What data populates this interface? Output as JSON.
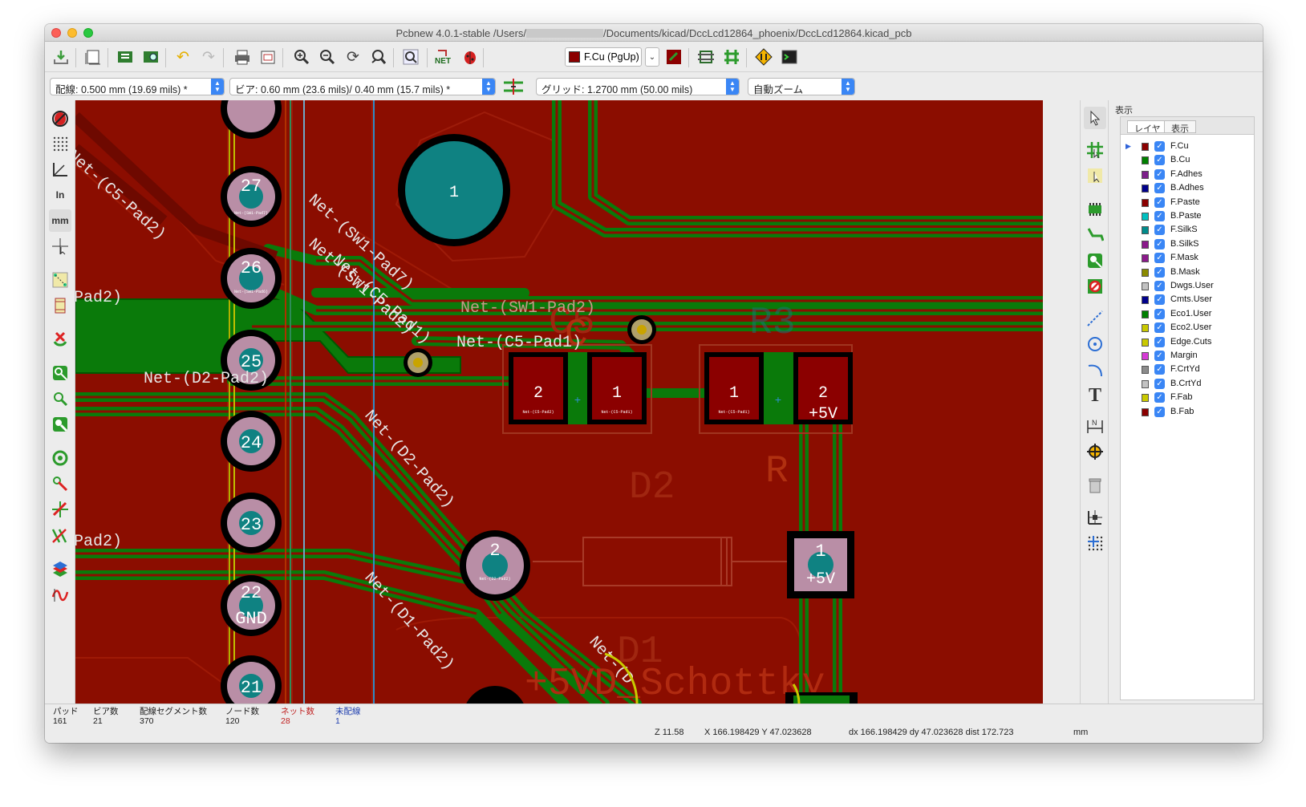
{
  "window": {
    "title_prefix": "Pcbnew 4.0.1-stable /Users/",
    "title_suffix": "/Documents/kicad/DccLcd12864_phoenix/DccLcd12864.kicad_pcb"
  },
  "toolbar": {
    "active_layer": "F.Cu (PgUp)",
    "layer_color": "#8b0000"
  },
  "toolbar2": {
    "track_width": "配線: 0.500 mm (19.69 mils) *",
    "via_size": "ビア: 0.60 mm (23.6 mils)/ 0.40 mm (15.7 mils) *",
    "grid": "グリッド: 1.2700 mm (50.00 mils)",
    "zoom": "自動ズーム"
  },
  "panel": {
    "title": "表示",
    "tabs": [
      "レイヤ",
      "表示"
    ],
    "layers": [
      {
        "name": "F.Cu",
        "color": "#8b0000",
        "checked": true,
        "active": true
      },
      {
        "name": "B.Cu",
        "color": "#008000",
        "checked": true,
        "active": false
      },
      {
        "name": "F.Adhes",
        "color": "#7d1f8a",
        "checked": true,
        "active": false
      },
      {
        "name": "B.Adhes",
        "color": "#00008b",
        "checked": true,
        "active": false
      },
      {
        "name": "F.Paste",
        "color": "#8b0000",
        "checked": true,
        "active": false
      },
      {
        "name": "B.Paste",
        "color": "#00c0c0",
        "checked": true,
        "active": false
      },
      {
        "name": "F.SilkS",
        "color": "#008b8b",
        "checked": true,
        "active": false
      },
      {
        "name": "B.SilkS",
        "color": "#8b1a8b",
        "checked": true,
        "active": false
      },
      {
        "name": "F.Mask",
        "color": "#8b1a8b",
        "checked": true,
        "active": false
      },
      {
        "name": "B.Mask",
        "color": "#8b8b00",
        "checked": true,
        "active": false
      },
      {
        "name": "Dwgs.User",
        "color": "#c2c2c2",
        "checked": true,
        "active": false
      },
      {
        "name": "Cmts.User",
        "color": "#00008b",
        "checked": true,
        "active": false
      },
      {
        "name": "Eco1.User",
        "color": "#008000",
        "checked": true,
        "active": false
      },
      {
        "name": "Eco2.User",
        "color": "#c9c900",
        "checked": true,
        "active": false
      },
      {
        "name": "Edge.Cuts",
        "color": "#c9c900",
        "checked": true,
        "active": false
      },
      {
        "name": "Margin",
        "color": "#d63ad6",
        "checked": true,
        "active": false
      },
      {
        "name": "F.CrtYd",
        "color": "#8b8b8b",
        "checked": true,
        "active": false
      },
      {
        "name": "B.CrtYd",
        "color": "#c2c2c2",
        "checked": true,
        "active": false
      },
      {
        "name": "F.Fab",
        "color": "#c9c900",
        "checked": true,
        "active": false
      },
      {
        "name": "B.Fab",
        "color": "#8b0000",
        "checked": true,
        "active": false
      }
    ]
  },
  "status": {
    "pads_label": "パッド",
    "pads": "161",
    "vias_label": "ビア数",
    "vias": "21",
    "segments_label": "配線セグメント数",
    "segments": "370",
    "nodes_label": "ノード数",
    "nodes": "120",
    "nets_label": "ネット数",
    "nets": "28",
    "unrouted_label": "未配線",
    "unrouted": "1",
    "zoom": "Z 11.58",
    "xy": "X 166.198429  Y 47.023628",
    "delta": "dx 166.198429  dy 47.023628  dist 172.723",
    "units": "mm"
  },
  "pcb": {
    "pads": {
      "p27": "27",
      "p26": "26",
      "p25": "25",
      "p24": "24",
      "p23": "23",
      "p22": "22",
      "p21": "21",
      "gnd": "GND",
      "big": "1",
      "c5_2": "2",
      "c5_1": "1",
      "r3_1": "1",
      "r3_2": "2",
      "r3_2_net": "+5V",
      "d2_2": "2",
      "d2_1": "1",
      "d2_1_net": "+5V"
    },
    "small_net": {
      "p27": "Net-(SW1-Pad7)",
      "p26": "Net-(SW1-Pad6)",
      "c5_2": "Net-(C5-Pad2)",
      "c5_1": "Net-(C5-Pad1)",
      "r3_1": "Net-(C5-Pad1)",
      "d2_2": "Net-(D2-Pad2)"
    },
    "nets": {
      "c5_pad2_top": "Net-(C5-Pad2)",
      "sw1_pad7": "Net-(SW1-Pad7)",
      "sw1_pad2": "Net-(SW1-Pad2)",
      "c5_pad1_diag": "Net-(C5-Pad1)",
      "sw1_pad2_h": "Net-(SW1-Pad2)",
      "c5_pad1_h": "Net-(C5-Pad1)",
      "d2_pad2_h": "Net-(D2-Pad2)",
      "d2_pad2_diag": "Net-(D2-Pad2)",
      "d1_pad2_diag": "Net-(D1-Pad2)",
      "pad2_a": "Pad2)",
      "pad2_b": "Pad2)",
      "net_d_bottom": "Net-(D"
    },
    "refs": {
      "c5": "C5",
      "c_fab": "C",
      "r3": "R3",
      "r": "R",
      "d2": "D2",
      "d1": "D1",
      "schottky": "+5VD_Schottky"
    }
  }
}
